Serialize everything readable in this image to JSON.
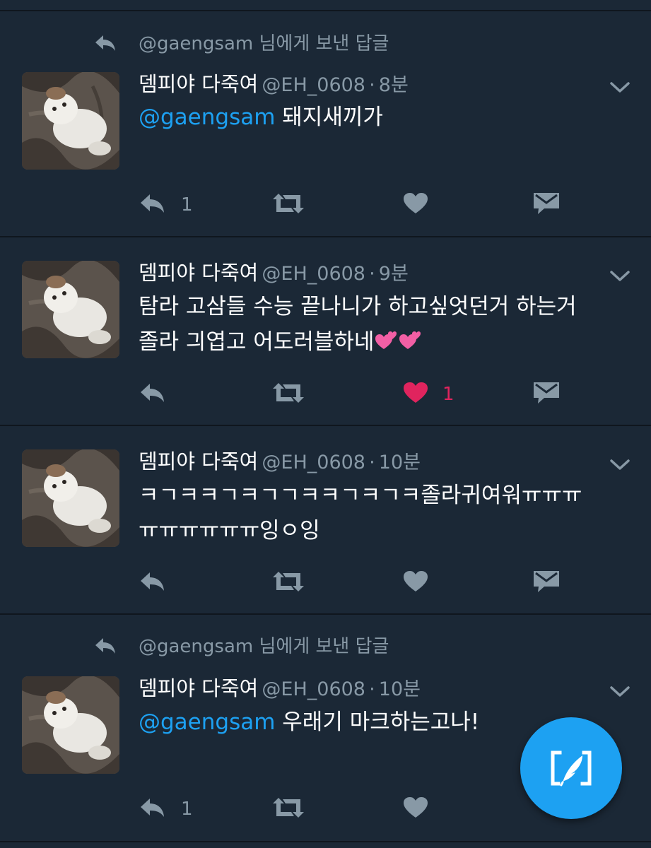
{
  "colors": {
    "background": "#1b2836",
    "divider": "#0f161e",
    "muted": "#8899a6",
    "link": "#1da1f2",
    "like": "#e0245e"
  },
  "tweets": [
    {
      "context": "@gaengsam 님에게 보낸 답글",
      "name": "뎀피야 다죽여",
      "handle": "@EH_0608",
      "dot": "·",
      "time": "8분",
      "mention": "@gaengsam",
      "lines": [
        " 돼지새끼가"
      ],
      "reply_count": "1",
      "like_count": "",
      "liked": false
    },
    {
      "context": "",
      "name": "뎀피야 다죽여",
      "handle": "@EH_0608",
      "dot": "·",
      "time": "9분",
      "mention": "",
      "lines": [
        "탐라 고삼들 수능 끝나니가 하고싶엇던거 하는거",
        "졸라 긔엽고 어도러블하네"
      ],
      "reply_count": "",
      "like_count": "1",
      "liked": true
    },
    {
      "context": "",
      "name": "뎀피야 다죽여",
      "handle": "@EH_0608",
      "dot": "·",
      "time": "10분",
      "mention": "",
      "lines": [
        "ㅋㄱㅋㅋㄱㅋㄱㄱㅋㅋㄱㅋㄱㅋ졸라귀여워ㅠㅠㅠ",
        "ㅠㅠㅠㅠㅠㅠ잉ㅇ잉"
      ],
      "reply_count": "",
      "like_count": "",
      "liked": false
    },
    {
      "context": "@gaengsam 님에게 보낸 답글",
      "name": "뎀피야 다죽여",
      "handle": "@EH_0608",
      "dot": "·",
      "time": "10분",
      "mention": "@gaengsam",
      "lines": [
        " 우래기 마크하는고나!"
      ],
      "reply_count": "1",
      "like_count": "",
      "liked": false
    }
  ],
  "icons": {
    "context": "reply-arrow-icon",
    "caret": "chevron-down-icon",
    "reply": "reply-icon",
    "retweet": "retweet-icon",
    "like": "heart-icon",
    "dm": "direct-message-icon",
    "compose": "compose-tweet-icon",
    "emoji": "two-hearts-emoji"
  }
}
